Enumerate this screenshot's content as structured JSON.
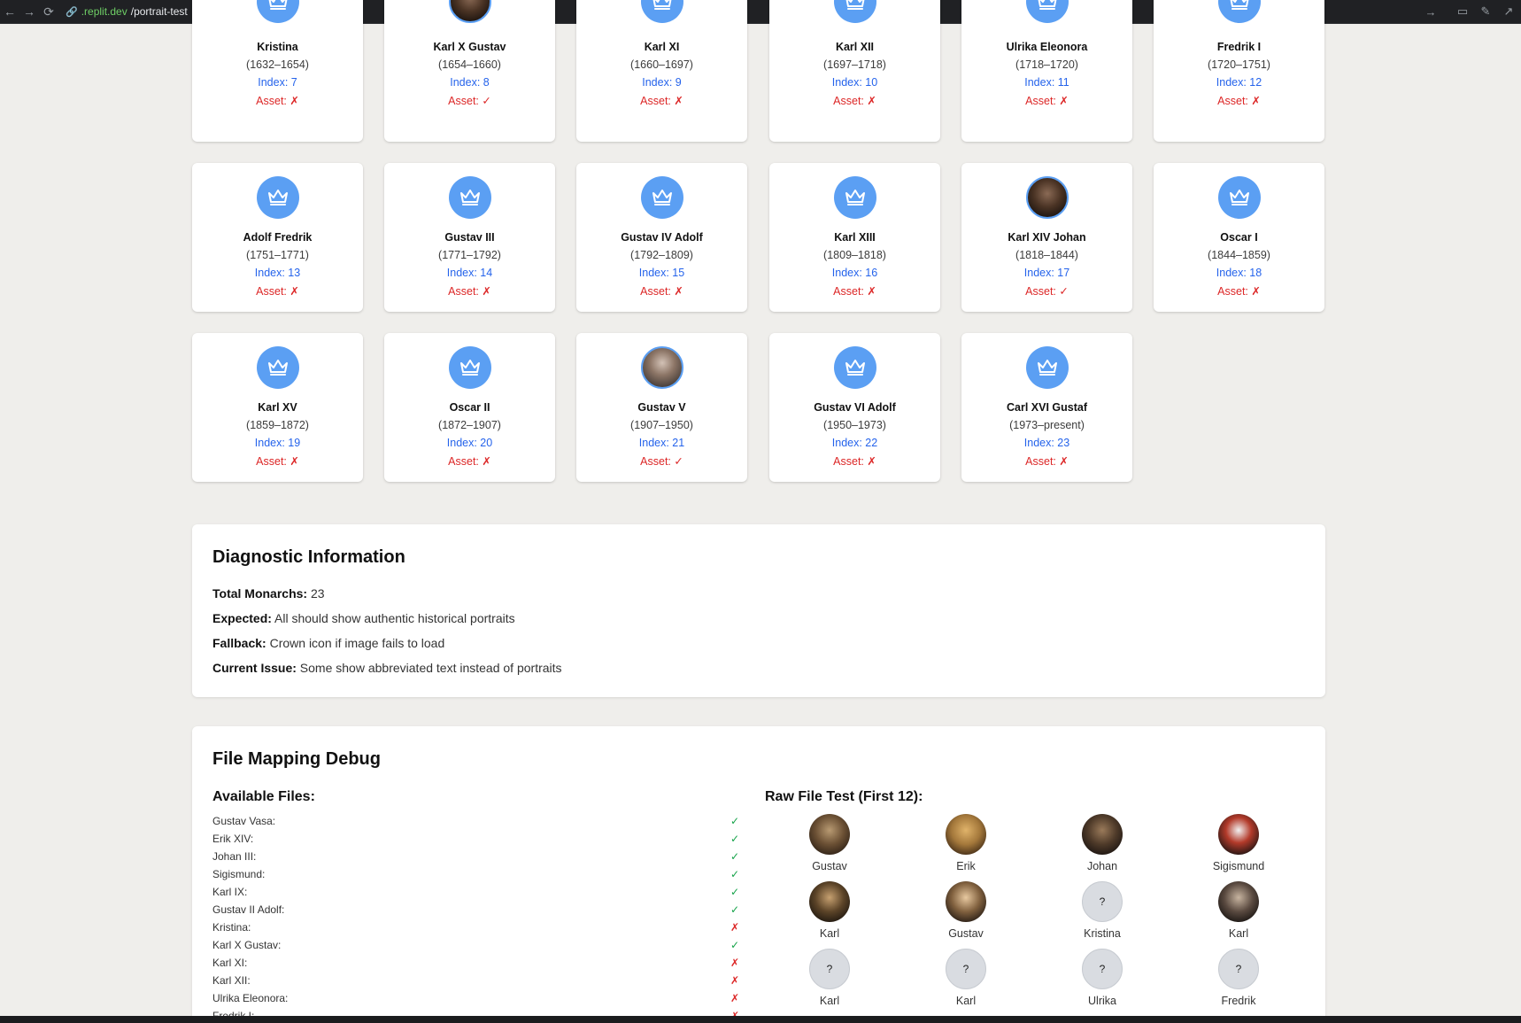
{
  "browser": {
    "url_domain": ".replit.dev",
    "url_path": "/portrait-test"
  },
  "monarchs": [
    {
      "name": "Kristina",
      "years": "(1632–1654)",
      "index": "Index: 7",
      "asset": "Asset: ✗",
      "portrait": false
    },
    {
      "name": "Karl X Gustav",
      "years": "(1654–1660)",
      "index": "Index: 8",
      "asset": "Asset: ✓",
      "portrait": true
    },
    {
      "name": "Karl XI",
      "years": "(1660–1697)",
      "index": "Index: 9",
      "asset": "Asset: ✗",
      "portrait": false
    },
    {
      "name": "Karl XII",
      "years": "(1697–1718)",
      "index": "Index: 10",
      "asset": "Asset: ✗",
      "portrait": false
    },
    {
      "name": "Ulrika Eleonora",
      "years": "(1718–1720)",
      "index": "Index: 11",
      "asset": "Asset: ✗",
      "portrait": false
    },
    {
      "name": "Fredrik I",
      "years": "(1720–1751)",
      "index": "Index: 12",
      "asset": "Asset: ✗",
      "portrait": false
    },
    {
      "name": "Adolf Fredrik",
      "years": "(1751–1771)",
      "index": "Index: 13",
      "asset": "Asset: ✗",
      "portrait": false
    },
    {
      "name": "Gustav III",
      "years": "(1771–1792)",
      "index": "Index: 14",
      "asset": "Asset: ✗",
      "portrait": false
    },
    {
      "name": "Gustav IV Adolf",
      "years": "(1792–1809)",
      "index": "Index: 15",
      "asset": "Asset: ✗",
      "portrait": false
    },
    {
      "name": "Karl XIII",
      "years": "(1809–1818)",
      "index": "Index: 16",
      "asset": "Asset: ✗",
      "portrait": false
    },
    {
      "name": "Karl XIV Johan",
      "years": "(1818–1844)",
      "index": "Index: 17",
      "asset": "Asset: ✓",
      "portrait": true
    },
    {
      "name": "Oscar I",
      "years": "(1844–1859)",
      "index": "Index: 18",
      "asset": "Asset: ✗",
      "portrait": false
    },
    {
      "name": "Karl XV",
      "years": "(1859–1872)",
      "index": "Index: 19",
      "asset": "Asset: ✗",
      "portrait": false
    },
    {
      "name": "Oscar II",
      "years": "(1872–1907)",
      "index": "Index: 20",
      "asset": "Asset: ✗",
      "portrait": false
    },
    {
      "name": "Gustav V",
      "years": "(1907–1950)",
      "index": "Index: 21",
      "asset": "Asset: ✓",
      "portrait": true
    },
    {
      "name": "Gustav VI Adolf",
      "years": "(1950–1973)",
      "index": "Index: 22",
      "asset": "Asset: ✗",
      "portrait": false
    },
    {
      "name": "Carl XVI Gustaf",
      "years": "(1973–present)",
      "index": "Index: 23",
      "asset": "Asset: ✗",
      "portrait": false
    }
  ],
  "diagnostic": {
    "title": "Diagnostic Information",
    "total_label": "Total Monarchs:",
    "total_value": " 23",
    "expected_label": "Expected:",
    "expected_value": " All should show authentic historical portraits",
    "fallback_label": "Fallback:",
    "fallback_value": " Crown icon if image fails to load",
    "issue_label": "Current Issue:",
    "issue_value": " Some show abbreviated text instead of portraits"
  },
  "file_mapping": {
    "title": "File Mapping Debug",
    "available_title": "Available Files:",
    "raw_title": "Raw File Test (First 12):",
    "files": [
      {
        "name": "Gustav Vasa:",
        "status": "✓"
      },
      {
        "name": "Erik XIV:",
        "status": "✓"
      },
      {
        "name": "Johan III:",
        "status": "✓"
      },
      {
        "name": "Sigismund:",
        "status": "✓"
      },
      {
        "name": "Karl IX:",
        "status": "✓"
      },
      {
        "name": "Gustav II Adolf:",
        "status": "✓"
      },
      {
        "name": "Kristina:",
        "status": "✗"
      },
      {
        "name": "Karl X Gustav:",
        "status": "✓"
      },
      {
        "name": "Karl XI:",
        "status": "✗"
      },
      {
        "name": "Karl XII:",
        "status": "✗"
      },
      {
        "name": "Ulrika Eleonora:",
        "status": "✗"
      },
      {
        "name": "Fredrik I:",
        "status": "✗"
      }
    ],
    "raw": [
      {
        "label": "Gustav",
        "thumb": "p1",
        "text": ""
      },
      {
        "label": "Erik",
        "thumb": "p2",
        "text": ""
      },
      {
        "label": "Johan",
        "thumb": "p3",
        "text": ""
      },
      {
        "label": "Sigismund",
        "thumb": "p4",
        "text": ""
      },
      {
        "label": "Karl",
        "thumb": "p5",
        "text": ""
      },
      {
        "label": "Gustav",
        "thumb": "p6",
        "text": ""
      },
      {
        "label": "Kristina",
        "thumb": "q",
        "text": "?"
      },
      {
        "label": "Karl",
        "thumb": "p7",
        "text": ""
      },
      {
        "label": "Karl",
        "thumb": "q",
        "text": "?"
      },
      {
        "label": "Karl",
        "thumb": "q",
        "text": "?"
      },
      {
        "label": "Ulrika",
        "thumb": "q",
        "text": "?"
      },
      {
        "label": "Fredrik",
        "thumb": "q",
        "text": "?"
      }
    ]
  }
}
